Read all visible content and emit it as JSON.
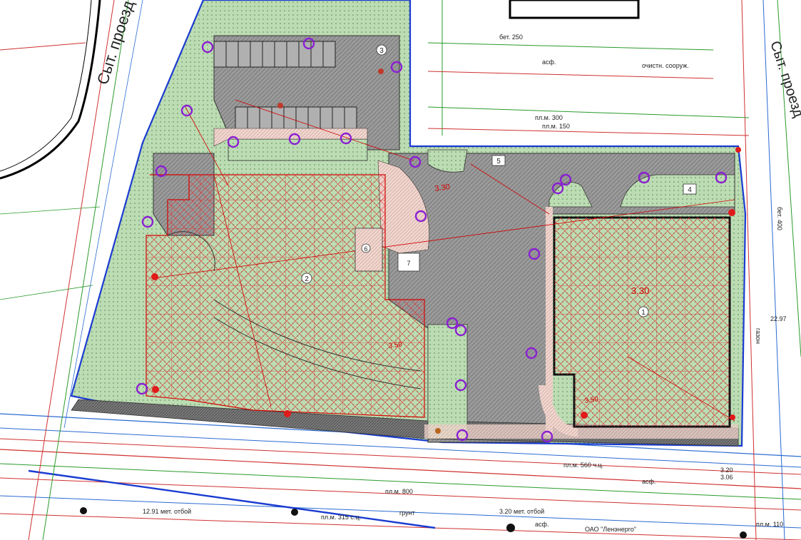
{
  "streets": {
    "top_left": "Сыт. проезд",
    "top_right": "Сыт. проезд"
  },
  "building_numbers": {
    "b1": "1",
    "b2": "2",
    "b3": "3",
    "b4": "4",
    "b5": "5",
    "b6": "6",
    "b7": "7"
  },
  "red_marks": {
    "m1": "3.30",
    "m2": "3.30",
    "m3": "3.50",
    "m4": "3.50"
  },
  "utility_labels": {
    "l1": "пл.м. 315 с.ц.",
    "l2": "пл.м. 560 ч.ц.",
    "l3": "пл.м. 800",
    "l4": "пл.м. 110",
    "l5": "12.91 мет. отбой",
    "l6": "3.20 мет. отбой",
    "l7": "3.20",
    "l8": "3.06",
    "l9": "ОАО \"Ленэнерго\"",
    "l10": "асф.",
    "l11": "бет. 250",
    "l12": "пл.м. 300",
    "l13": "пл.м. 150",
    "l14": "газон",
    "l15": "очистн. сооруж.",
    "l16": "бет. 400",
    "l17": "22.97",
    "l18": "асф.",
    "l19": "грунт",
    "l20": "асф."
  },
  "colors": {
    "hatch": "#d40000",
    "green_area": "#a8d0a0",
    "gray_area": "#8a8a8a",
    "tree_circle": "#8a1fd1",
    "tree_red": "#e11a1a",
    "property_line": "#1a3bd1"
  }
}
